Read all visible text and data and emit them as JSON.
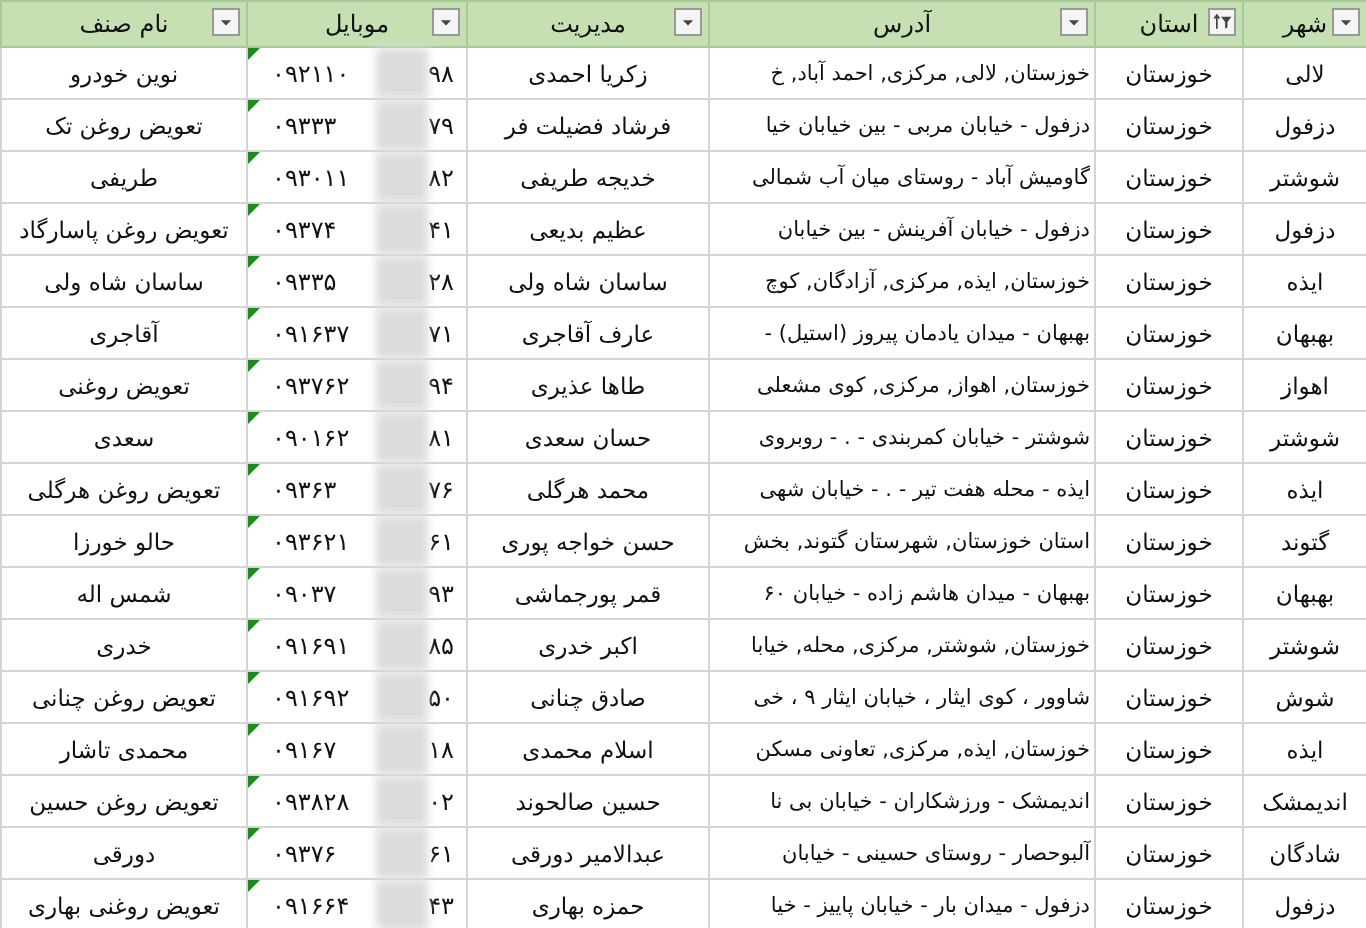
{
  "columns": [
    {
      "label": "شهر",
      "sorted_filtered": false
    },
    {
      "label": "استان",
      "sorted_filtered": true
    },
    {
      "label": "آدرس",
      "sorted_filtered": false
    },
    {
      "label": "مدیریت",
      "sorted_filtered": false
    },
    {
      "label": "موبایل",
      "sorted_filtered": false
    },
    {
      "label": "نام صنف",
      "sorted_filtered": false
    }
  ],
  "rows": [
    {
      "city": "لالی",
      "province": "خوزستان",
      "address": "خوزستان, لالی, مرکزی, احمد آباد, خ",
      "manager": "زکریا احمدی",
      "mobile_start": "۰۹۲۱۱۰",
      "mobile_end": "۹۸",
      "number_as_text": true,
      "business_name": "نوین خودرو"
    },
    {
      "city": "دزفول",
      "province": "خوزستان",
      "address": "دزفول - خیابان مربی - بین خیابان خیا",
      "manager": "فرشاد فضیلت فر",
      "mobile_start": "۰۹۳۳۳",
      "mobile_end": "۷۹",
      "number_as_text": true,
      "business_name": "تعویض روغن تک"
    },
    {
      "city": "شوشتر",
      "province": "خوزستان",
      "address": "گاومیش آباد - روستای میان آب شمالی",
      "manager": "خدیجه طریفی",
      "mobile_start": "۰۹۳۰۱۱",
      "mobile_end": "۸۲",
      "number_as_text": true,
      "business_name": "طریفی"
    },
    {
      "city": "دزفول",
      "province": "خوزستان",
      "address": "دزفول - خیابان آفرینش - بین خیابان",
      "manager": "عظیم بدیعی",
      "mobile_start": "۰۹۳۷۴",
      "mobile_end": "۴۱",
      "number_as_text": true,
      "business_name": "تعویض روغن پاسارگاد"
    },
    {
      "city": "ایذه",
      "province": "خوزستان",
      "address": "خوزستان, ایذه, مرکزی, آزادگان, کوچ",
      "manager": "ساسان شاه ولی",
      "mobile_start": "۰۹۳۳۵",
      "mobile_end": "۲۸",
      "number_as_text": true,
      "business_name": "ساسان شاه ولی"
    },
    {
      "city": "بهبهان",
      "province": "خوزستان",
      "address": "بهبهان - میدان یادمان پیروز (استیل) -",
      "manager": "عارف آقاجری",
      "mobile_start": "۰۹۱۶۳۷",
      "mobile_end": "۷۱",
      "number_as_text": true,
      "business_name": "آقاجری"
    },
    {
      "city": "اهواز",
      "province": "خوزستان",
      "address": "خوزستان, اهواز, مرکزی, کوی مشعلی",
      "manager": "طاها عذیری",
      "mobile_start": "۰۹۳۷۶۲",
      "mobile_end": "۹۴",
      "number_as_text": true,
      "business_name": "تعویض روغنی"
    },
    {
      "city": "شوشتر",
      "province": "خوزستان",
      "address": "شوشتر - خیابان کمربندی - . - روبروی",
      "manager": "حسان سعدی",
      "mobile_start": "۰۹۰۱۶۲",
      "mobile_end": "۸۱",
      "number_as_text": true,
      "business_name": "سعدی"
    },
    {
      "city": "ایذه",
      "province": "خوزستان",
      "address": "ایذه - محله هفت تیر - . - خیابان شهی",
      "manager": "محمد هرگلی",
      "mobile_start": "۰۹۳۶۳",
      "mobile_end": "۷۶",
      "number_as_text": true,
      "business_name": "تعویض روغن هرگلی"
    },
    {
      "city": "گتوند",
      "province": "خوزستان",
      "address": "استان خوزستان, شهرستان گتوند, بخش",
      "manager": "حسن خواجه پوری",
      "mobile_start": "۰۹۳۶۲۱",
      "mobile_end": "۶۱",
      "number_as_text": true,
      "business_name": "حالو خورزا"
    },
    {
      "city": "بهبهان",
      "province": "خوزستان",
      "address": "بهبهان - میدان هاشم زاده - خیابان ۶۰",
      "manager": "قمر پورجماشی",
      "mobile_start": "۰۹۰۳۷",
      "mobile_end": "۹۳",
      "number_as_text": true,
      "business_name": "شمس اله"
    },
    {
      "city": "شوشتر",
      "province": "خوزستان",
      "address": "خوزستان, شوشتر, مرکزی, محله, خیابا",
      "manager": "اکبر خدری",
      "mobile_start": "۰۹۱۶۹۱",
      "mobile_end": "۸۵",
      "number_as_text": true,
      "business_name": "خدری"
    },
    {
      "city": "شوش",
      "province": "خوزستان",
      "address": "شاوور ، کوی ایثار ، خیابان ایثار ۹ ، خی",
      "manager": "صادق چنانی",
      "mobile_start": "۰۹۱۶۹۲",
      "mobile_end": "۵۰",
      "number_as_text": true,
      "business_name": "تعویض روغن چنانی"
    },
    {
      "city": "ایذه",
      "province": "خوزستان",
      "address": "خوزستان, ایذه, مرکزی, تعاونی مسکن",
      "manager": "اسلام محمدی",
      "mobile_start": "۰۹۱۶۷",
      "mobile_end": "۱۸",
      "number_as_text": true,
      "business_name": "محمدی تاشار"
    },
    {
      "city": "اندیمشک",
      "province": "خوزستان",
      "address": "اندیمشک - ورزشکاران - خیابان بی نا",
      "manager": "حسین صالحوند",
      "mobile_start": "۰۹۳۸۲۸",
      "mobile_end": "۰۲",
      "number_as_text": true,
      "business_name": "تعویض روغن حسین"
    },
    {
      "city": "شادگان",
      "province": "خوزستان",
      "address": "آلبوحصار - روستای حسینی - خیابان",
      "manager": "عبدالامیر دورقی",
      "mobile_start": "۰۹۳۷۶",
      "mobile_end": "۶۱",
      "number_as_text": true,
      "business_name": "دورقی"
    },
    {
      "city": "دزفول",
      "province": "خوزستان",
      "address": "دزفول - میدان بار - خیابان پاییز - خیا",
      "manager": "حمزه بهاری",
      "mobile_start": "۰۹۱۶۶۴",
      "mobile_end": "۴۳",
      "number_as_text": true,
      "business_name": "تعویض روغنی بهاری"
    }
  ]
}
